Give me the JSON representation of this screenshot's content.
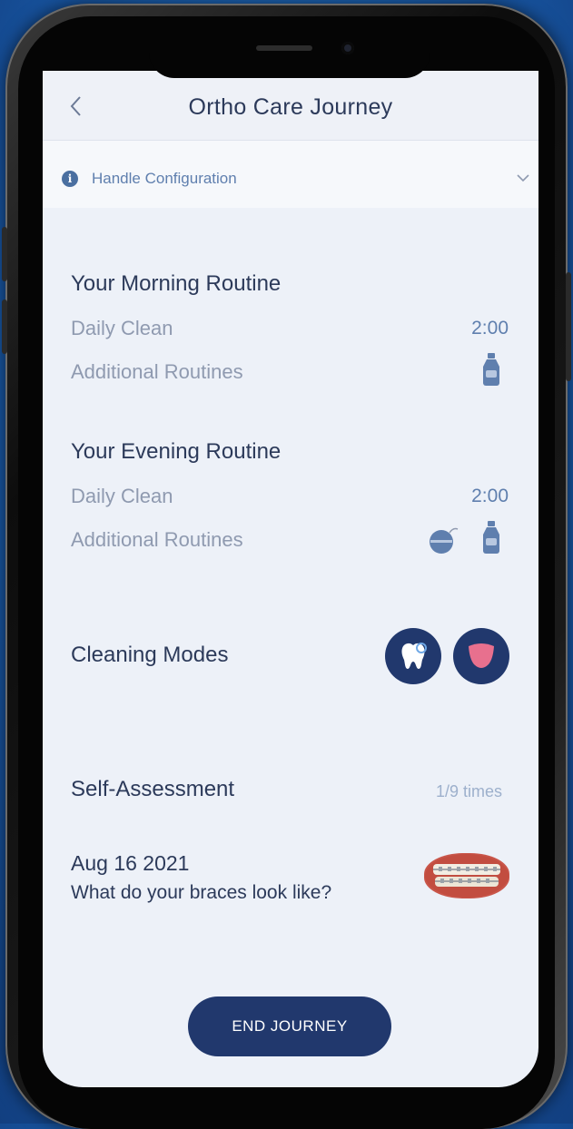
{
  "header": {
    "title": "Ortho Care Journey"
  },
  "config": {
    "label": "Handle Configuration"
  },
  "morning": {
    "title": "Your Morning Routine",
    "daily_clean_label": "Daily Clean",
    "daily_clean_time": "2:00",
    "additional_label": "Additional Routines",
    "additional_icons": [
      "mouthwash-bottle-icon"
    ]
  },
  "evening": {
    "title": "Your Evening Routine",
    "daily_clean_label": "Daily Clean",
    "daily_clean_time": "2:00",
    "additional_label": "Additional Routines",
    "additional_icons": [
      "floss-icon",
      "mouthwash-bottle-icon"
    ]
  },
  "modes": {
    "title": "Cleaning Modes",
    "buttons": [
      "tooth-sparkle-icon",
      "gum-care-icon"
    ]
  },
  "assessment": {
    "title": "Self-Assessment",
    "count": "1/9 times",
    "date": "Aug 16 2021",
    "question": "What do your braces look like?"
  },
  "footer": {
    "end_label": "END JOURNEY"
  },
  "colors": {
    "navy": "#21386d",
    "title_text": "#2c3a5a",
    "muted_text": "#8f9ab0",
    "accent_blue": "#5f7fae",
    "gum_pink": "#e8708e",
    "screen_bg": "#edf1f8"
  }
}
